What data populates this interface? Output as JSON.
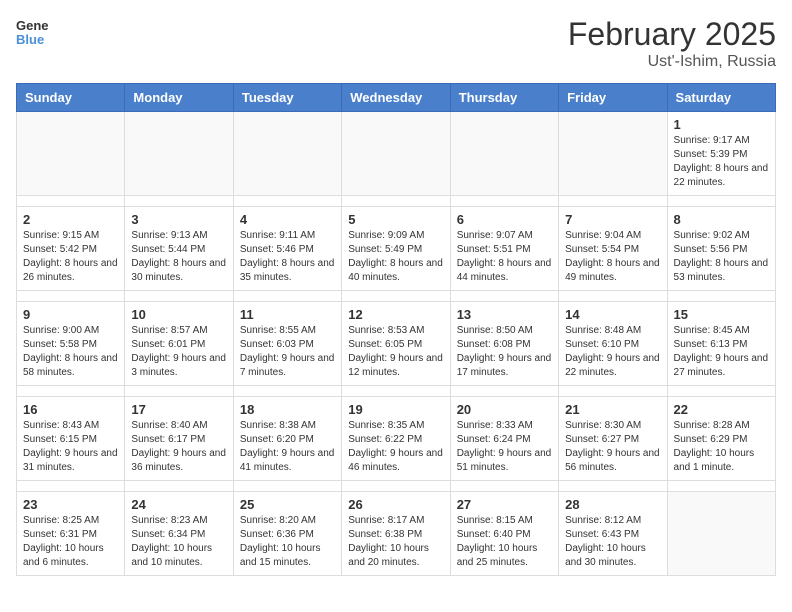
{
  "header": {
    "logo": {
      "general": "General",
      "blue": "Blue"
    },
    "title": "February 2025",
    "subtitle": "Ust'-Ishim, Russia"
  },
  "calendar": {
    "days_of_week": [
      "Sunday",
      "Monday",
      "Tuesday",
      "Wednesday",
      "Thursday",
      "Friday",
      "Saturday"
    ],
    "weeks": [
      [
        {
          "day": "",
          "info": ""
        },
        {
          "day": "",
          "info": ""
        },
        {
          "day": "",
          "info": ""
        },
        {
          "day": "",
          "info": ""
        },
        {
          "day": "",
          "info": ""
        },
        {
          "day": "",
          "info": ""
        },
        {
          "day": "1",
          "info": "Sunrise: 9:17 AM\nSunset: 5:39 PM\nDaylight: 8 hours and 22 minutes."
        }
      ],
      [
        {
          "day": "2",
          "info": "Sunrise: 9:15 AM\nSunset: 5:42 PM\nDaylight: 8 hours and 26 minutes."
        },
        {
          "day": "3",
          "info": "Sunrise: 9:13 AM\nSunset: 5:44 PM\nDaylight: 8 hours and 30 minutes."
        },
        {
          "day": "4",
          "info": "Sunrise: 9:11 AM\nSunset: 5:46 PM\nDaylight: 8 hours and 35 minutes."
        },
        {
          "day": "5",
          "info": "Sunrise: 9:09 AM\nSunset: 5:49 PM\nDaylight: 8 hours and 40 minutes."
        },
        {
          "day": "6",
          "info": "Sunrise: 9:07 AM\nSunset: 5:51 PM\nDaylight: 8 hours and 44 minutes."
        },
        {
          "day": "7",
          "info": "Sunrise: 9:04 AM\nSunset: 5:54 PM\nDaylight: 8 hours and 49 minutes."
        },
        {
          "day": "8",
          "info": "Sunrise: 9:02 AM\nSunset: 5:56 PM\nDaylight: 8 hours and 53 minutes."
        }
      ],
      [
        {
          "day": "9",
          "info": "Sunrise: 9:00 AM\nSunset: 5:58 PM\nDaylight: 8 hours and 58 minutes."
        },
        {
          "day": "10",
          "info": "Sunrise: 8:57 AM\nSunset: 6:01 PM\nDaylight: 9 hours and 3 minutes."
        },
        {
          "day": "11",
          "info": "Sunrise: 8:55 AM\nSunset: 6:03 PM\nDaylight: 9 hours and 7 minutes."
        },
        {
          "day": "12",
          "info": "Sunrise: 8:53 AM\nSunset: 6:05 PM\nDaylight: 9 hours and 12 minutes."
        },
        {
          "day": "13",
          "info": "Sunrise: 8:50 AM\nSunset: 6:08 PM\nDaylight: 9 hours and 17 minutes."
        },
        {
          "day": "14",
          "info": "Sunrise: 8:48 AM\nSunset: 6:10 PM\nDaylight: 9 hours and 22 minutes."
        },
        {
          "day": "15",
          "info": "Sunrise: 8:45 AM\nSunset: 6:13 PM\nDaylight: 9 hours and 27 minutes."
        }
      ],
      [
        {
          "day": "16",
          "info": "Sunrise: 8:43 AM\nSunset: 6:15 PM\nDaylight: 9 hours and 31 minutes."
        },
        {
          "day": "17",
          "info": "Sunrise: 8:40 AM\nSunset: 6:17 PM\nDaylight: 9 hours and 36 minutes."
        },
        {
          "day": "18",
          "info": "Sunrise: 8:38 AM\nSunset: 6:20 PM\nDaylight: 9 hours and 41 minutes."
        },
        {
          "day": "19",
          "info": "Sunrise: 8:35 AM\nSunset: 6:22 PM\nDaylight: 9 hours and 46 minutes."
        },
        {
          "day": "20",
          "info": "Sunrise: 8:33 AM\nSunset: 6:24 PM\nDaylight: 9 hours and 51 minutes."
        },
        {
          "day": "21",
          "info": "Sunrise: 8:30 AM\nSunset: 6:27 PM\nDaylight: 9 hours and 56 minutes."
        },
        {
          "day": "22",
          "info": "Sunrise: 8:28 AM\nSunset: 6:29 PM\nDaylight: 10 hours and 1 minute."
        }
      ],
      [
        {
          "day": "23",
          "info": "Sunrise: 8:25 AM\nSunset: 6:31 PM\nDaylight: 10 hours and 6 minutes."
        },
        {
          "day": "24",
          "info": "Sunrise: 8:23 AM\nSunset: 6:34 PM\nDaylight: 10 hours and 10 minutes."
        },
        {
          "day": "25",
          "info": "Sunrise: 8:20 AM\nSunset: 6:36 PM\nDaylight: 10 hours and 15 minutes."
        },
        {
          "day": "26",
          "info": "Sunrise: 8:17 AM\nSunset: 6:38 PM\nDaylight: 10 hours and 20 minutes."
        },
        {
          "day": "27",
          "info": "Sunrise: 8:15 AM\nSunset: 6:40 PM\nDaylight: 10 hours and 25 minutes."
        },
        {
          "day": "28",
          "info": "Sunrise: 8:12 AM\nSunset: 6:43 PM\nDaylight: 10 hours and 30 minutes."
        },
        {
          "day": "",
          "info": ""
        }
      ]
    ]
  }
}
